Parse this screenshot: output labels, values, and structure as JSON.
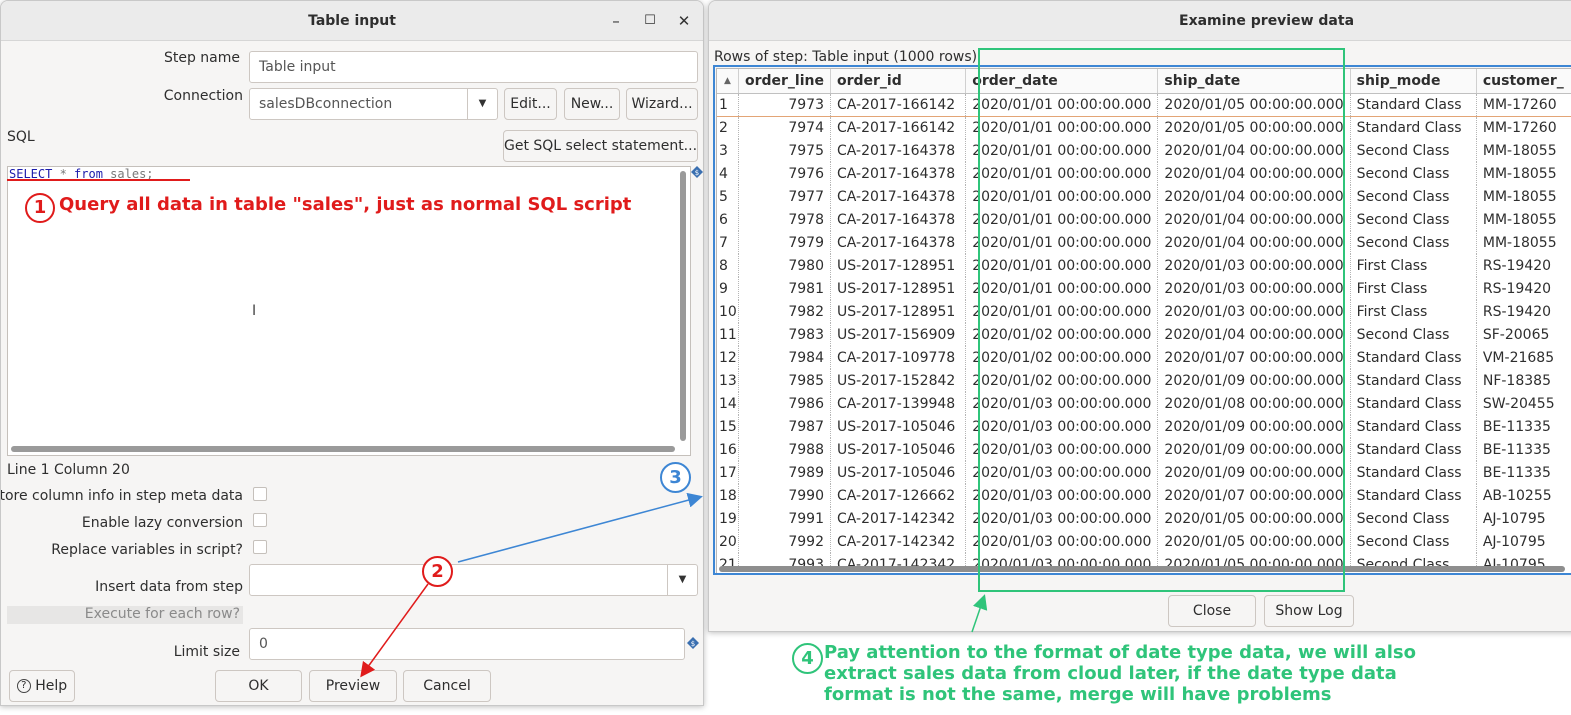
{
  "left_window": {
    "title": "Table input",
    "controls": {
      "minimize": "–",
      "maximize": "☐",
      "close": "✕"
    },
    "step_name_label": "Step name",
    "step_name_value": "Table input",
    "connection_label": "Connection",
    "connection_value": "salesDBconnection",
    "edit_button": "Edit...",
    "new_button": "New...",
    "wizard_button": "Wizard...",
    "sql_label": "SQL",
    "get_sql_button": "Get SQL select statement...",
    "sql": {
      "kw1": "SELECT",
      "rest1": " * ",
      "kw2": "from",
      "rest2": " sales;"
    },
    "cursor_position": "Line 1 Column 20",
    "store_column_label": "Store column info in step meta data",
    "lazy_conversion_label": "Enable lazy conversion",
    "replace_vars_label": "Replace variables in script?",
    "insert_data_label": "Insert data from step",
    "execute_each_row_label": "Execute for each row?",
    "limit_size_label": "Limit size",
    "limit_size_value": "0",
    "help_button": "Help",
    "ok_button": "OK",
    "preview_button": "Preview",
    "cancel_button": "Cancel"
  },
  "right_window": {
    "title": "Examine preview data",
    "rows_label": "Rows of step: Table input (1000 rows)",
    "columns": [
      "order_line",
      "order_id",
      "order_date",
      "ship_date",
      "ship_mode",
      "customer_"
    ],
    "rows": [
      [
        "1",
        "7973",
        "CA-2017-166142",
        "2020/01/01 00:00:00.000",
        "2020/01/05 00:00:00.000",
        "Standard Class",
        "MM-17260"
      ],
      [
        "2",
        "7974",
        "CA-2017-166142",
        "2020/01/01 00:00:00.000",
        "2020/01/05 00:00:00.000",
        "Standard Class",
        "MM-17260"
      ],
      [
        "3",
        "7975",
        "CA-2017-164378",
        "2020/01/01 00:00:00.000",
        "2020/01/04 00:00:00.000",
        "Second Class",
        "MM-18055"
      ],
      [
        "4",
        "7976",
        "CA-2017-164378",
        "2020/01/01 00:00:00.000",
        "2020/01/04 00:00:00.000",
        "Second Class",
        "MM-18055"
      ],
      [
        "5",
        "7977",
        "CA-2017-164378",
        "2020/01/01 00:00:00.000",
        "2020/01/04 00:00:00.000",
        "Second Class",
        "MM-18055"
      ],
      [
        "6",
        "7978",
        "CA-2017-164378",
        "2020/01/01 00:00:00.000",
        "2020/01/04 00:00:00.000",
        "Second Class",
        "MM-18055"
      ],
      [
        "7",
        "7979",
        "CA-2017-164378",
        "2020/01/01 00:00:00.000",
        "2020/01/04 00:00:00.000",
        "Second Class",
        "MM-18055"
      ],
      [
        "8",
        "7980",
        "US-2017-128951",
        "2020/01/01 00:00:00.000",
        "2020/01/03 00:00:00.000",
        "First Class",
        "RS-19420"
      ],
      [
        "9",
        "7981",
        "US-2017-128951",
        "2020/01/01 00:00:00.000",
        "2020/01/03 00:00:00.000",
        "First Class",
        "RS-19420"
      ],
      [
        "10",
        "7982",
        "US-2017-128951",
        "2020/01/01 00:00:00.000",
        "2020/01/03 00:00:00.000",
        "First Class",
        "RS-19420"
      ],
      [
        "11",
        "7983",
        "US-2017-156909",
        "2020/01/02 00:00:00.000",
        "2020/01/04 00:00:00.000",
        "Second Class",
        "SF-20065"
      ],
      [
        "12",
        "7984",
        "CA-2017-109778",
        "2020/01/02 00:00:00.000",
        "2020/01/07 00:00:00.000",
        "Standard Class",
        "VM-21685"
      ],
      [
        "13",
        "7985",
        "US-2017-152842",
        "2020/01/02 00:00:00.000",
        "2020/01/09 00:00:00.000",
        "Standard Class",
        "NF-18385"
      ],
      [
        "14",
        "7986",
        "CA-2017-139948",
        "2020/01/03 00:00:00.000",
        "2020/01/08 00:00:00.000",
        "Standard Class",
        "SW-20455"
      ],
      [
        "15",
        "7987",
        "US-2017-105046",
        "2020/01/03 00:00:00.000",
        "2020/01/09 00:00:00.000",
        "Standard Class",
        "BE-11335"
      ],
      [
        "16",
        "7988",
        "US-2017-105046",
        "2020/01/03 00:00:00.000",
        "2020/01/09 00:00:00.000",
        "Standard Class",
        "BE-11335"
      ],
      [
        "17",
        "7989",
        "US-2017-105046",
        "2020/01/03 00:00:00.000",
        "2020/01/09 00:00:00.000",
        "Standard Class",
        "BE-11335"
      ],
      [
        "18",
        "7990",
        "CA-2017-126662",
        "2020/01/03 00:00:00.000",
        "2020/01/07 00:00:00.000",
        "Standard Class",
        "AB-10255"
      ],
      [
        "19",
        "7991",
        "CA-2017-142342",
        "2020/01/03 00:00:00.000",
        "2020/01/05 00:00:00.000",
        "Second Class",
        "AJ-10795"
      ],
      [
        "20",
        "7992",
        "CA-2017-142342",
        "2020/01/03 00:00:00.000",
        "2020/01/05 00:00:00.000",
        "Second Class",
        "AJ-10795"
      ],
      [
        "21",
        "7993",
        "CA-2017-142342",
        "2020/01/03 00:00:00.000",
        "2020/01/05 00:00:00.000",
        "Second Class",
        "AJ-10795"
      ]
    ],
    "close_button": "Close",
    "show_log_button": "Show Log"
  },
  "annotations": {
    "n1": "1",
    "text1": "Query all data in table \"sales\", just as normal SQL script",
    "n2": "2",
    "n3": "3",
    "n4": "4",
    "text4_line1": "Pay attention to the format of date type data, we will also",
    "text4_line2": "extract sales data from cloud later, if the date type data",
    "text4_line3": "format is not the same, merge will have problems",
    "red": "#e01b1b",
    "blue": "#3d86d4",
    "green": "#2fc47a"
  }
}
